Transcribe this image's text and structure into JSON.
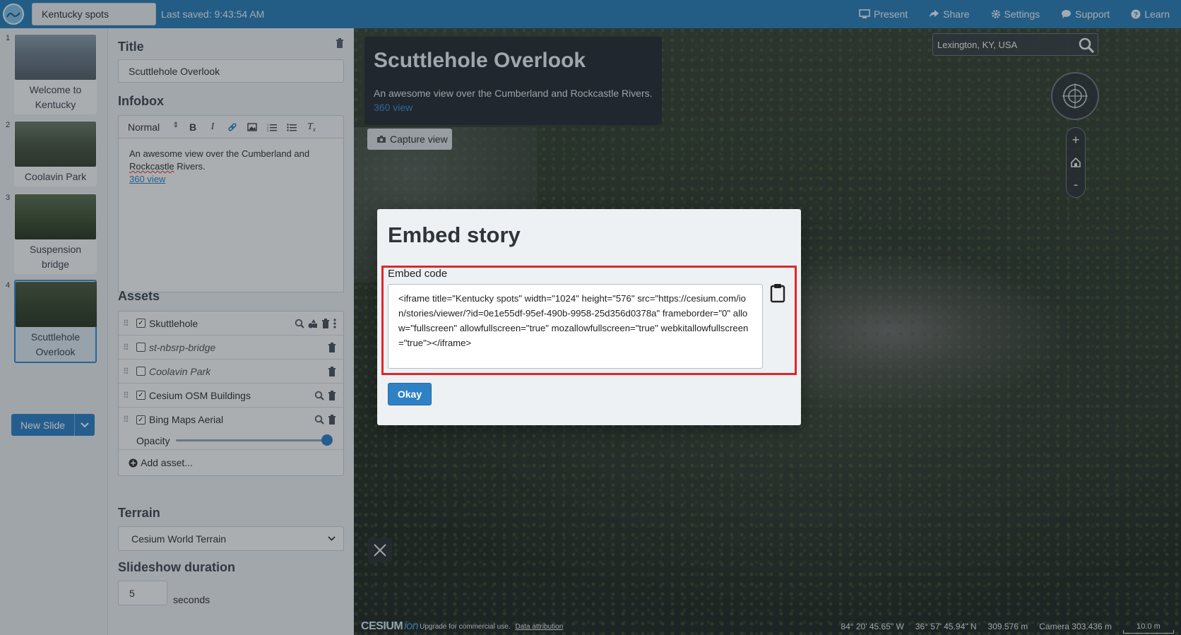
{
  "topbar": {
    "story_name": "Kentucky spots",
    "last_saved": "Last saved: 9:43:54 AM",
    "nav": [
      {
        "label": "Present",
        "icon": "monitor-icon"
      },
      {
        "label": "Share",
        "icon": "share-icon"
      },
      {
        "label": "Settings",
        "icon": "gear-icon"
      },
      {
        "label": "Support",
        "icon": "chat-icon"
      },
      {
        "label": "Learn",
        "icon": "help-icon"
      }
    ]
  },
  "slides": {
    "items": [
      {
        "number": "1",
        "label": "Welcome to Kentucky"
      },
      {
        "number": "2",
        "label": "Coolavin Park"
      },
      {
        "number": "3",
        "label": "Suspension bridge"
      },
      {
        "number": "4",
        "label": "Scuttlehole Overlook"
      }
    ],
    "active_index": 3,
    "new_slide_label": "New Slide"
  },
  "editor": {
    "title_heading": "Title",
    "title_value": "Scuttlehole Overlook",
    "infobox_heading": "Infobox",
    "format_select": "Normal",
    "infobox_text_1": "An awesome view over the Cumberland and",
    "infobox_text_2a": "Rockcastle",
    "infobox_text_2b": " Rivers.",
    "infobox_link": "360 view",
    "assets_heading": "Assets",
    "assets": [
      {
        "name": "Skuttlehole",
        "checked": true
      },
      {
        "name": "st-nbsrp-bridge",
        "checked": false
      },
      {
        "name": "Coolavin Park",
        "checked": false
      },
      {
        "name": "Cesium OSM Buildings",
        "checked": true
      },
      {
        "name": "Bing Maps Aerial",
        "checked": true
      }
    ],
    "opacity_label": "Opacity",
    "opacity_value": 1.0,
    "add_asset_label": "Add asset...",
    "terrain_heading": "Terrain",
    "terrain_value": "Cesium World Terrain",
    "duration_heading": "Slideshow duration",
    "duration_value": "5",
    "duration_unit": "seconds"
  },
  "viewport": {
    "infobox_title": "Scuttlehole Overlook",
    "infobox_text": "An awesome view over the Cumberland and Rockcastle Rivers.",
    "infobox_link": "360 view",
    "capture_label": "Capture view",
    "search_value": "Lexington, KY, USA",
    "zoom_in": "+",
    "zoom_out": "-",
    "logo_text": "CESIUM",
    "logo_ion": "ion",
    "upgrade_text": "Upgrade for commercial use.",
    "attribution_text": "Data attribution",
    "longitude": "84° 20' 45.65\" W",
    "latitude": "36° 57' 45.94\" N",
    "elevation": "309.576 m",
    "camera": "Camera 303.436 m",
    "scale": "10.0 m"
  },
  "modal": {
    "title": "Embed story",
    "embed_label": "Embed code",
    "embed_code": "<iframe title=\"Kentucky spots\" width=\"1024\" height=\"576\" src=\"https://cesium.com/ion/stories/viewer/?id=0e1e55df-95ef-490b-9958-25d356d0378a\" frameborder=\"0\" allow=\"fullscreen\" allowfullscreen=\"true\" mozallowfullscreen=\"true\" webkitallowfullscreen=\"true\"></iframe>",
    "okay_label": "Okay"
  },
  "colors": {
    "topbar": "#2c7fb8",
    "accent": "#2f81c5",
    "highlight": "#e0262b"
  }
}
